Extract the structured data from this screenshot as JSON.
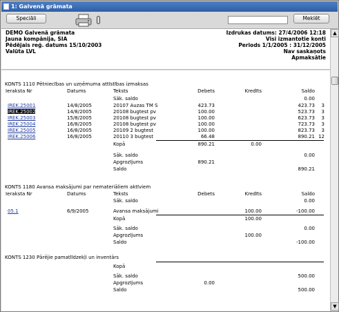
{
  "window": {
    "title": "1: Galvenā grāmata"
  },
  "toolbar": {
    "special_label": "Speciāli",
    "find_label": "Meklēt",
    "search_value": ""
  },
  "header": {
    "company": "DEMO Galvenā grāmata",
    "company2": "Jauna kompānija, SIA",
    "last_reg": "Pēdējais reģ. datums  15/10/2003",
    "currency": "Valūta LVL",
    "print_date": "Izdrukas datums: 27/4/2006 12:18",
    "unused": "Visi izmantotie konti",
    "period": "Periods  1/1/2005 : 31/12/2005",
    "not_agreed": "Nav saskaņots",
    "unpaid": "Apmaksātie"
  },
  "columns": [
    "Ieraksta Nr",
    "Datums",
    "Teksts",
    "Debets",
    "Kredīts",
    "Saldo"
  ],
  "labels": {
    "opening": "Sāk. saldo",
    "total": "Kopā",
    "turnover": "Apgrozījums",
    "balance": "Saldo"
  },
  "accounts": [
    {
      "title": "KONTS 1110  Pētniecības un uzņēmuma attīstības izmaksas",
      "opening": "0.00",
      "rows": [
        {
          "nr": "IREK.25001",
          "date": "14/8/2005",
          "text": "20107 Auzas TM S",
          "debit": "423.73",
          "balance": "423.73",
          "n": "3"
        },
        {
          "nr": "IREK.25002",
          "date": "14/8/2005",
          "text": "20108 bugtest pv",
          "debit": "100.00",
          "balance": "523.73",
          "n": "3"
        },
        {
          "nr": "IREK.25003",
          "date": "15/8/2005",
          "text": "20108 bugtest pv",
          "debit": "100.00",
          "balance": "623.73",
          "n": "3"
        },
        {
          "nr": "IREK.25004",
          "date": "16/8/2005",
          "text": "20108 bugtest pv",
          "debit": "100.00",
          "balance": "723.73",
          "n": "3"
        },
        {
          "nr": "IREK.25005",
          "date": "16/8/2005",
          "text": "20109 2 bugtest",
          "debit": "100.00",
          "balance": "823.73",
          "n": "3"
        },
        {
          "nr": "IREK.25006",
          "date": "16/8/2005",
          "text": "20110 3 bugtest",
          "debit": "66.48",
          "balance": "890.21",
          "n": "12"
        }
      ],
      "total_debit": "890.21",
      "total_credit": "0.00",
      "open2": "0.00",
      "turnover": "890.21",
      "saldo": "890.21"
    },
    {
      "title": "KONTS 1180  Avansa maksājumi par nemateriāliem aktīviem",
      "opening": "0.00",
      "rows": [
        {
          "nr": "05.1",
          "date": "6/9/2005",
          "text": "Avansa maksājumi",
          "credit": "100.00",
          "balance": "-100.00"
        }
      ],
      "total_credit": "100.00",
      "open2": "0.00",
      "turnover": "100.00",
      "saldo": "-100.00"
    },
    {
      "title": "KONTS 1230  Pārējie pamatlīdzekļi un inventārs",
      "open2": "500.00",
      "turnover": "0.00",
      "saldo": "500.00"
    }
  ]
}
